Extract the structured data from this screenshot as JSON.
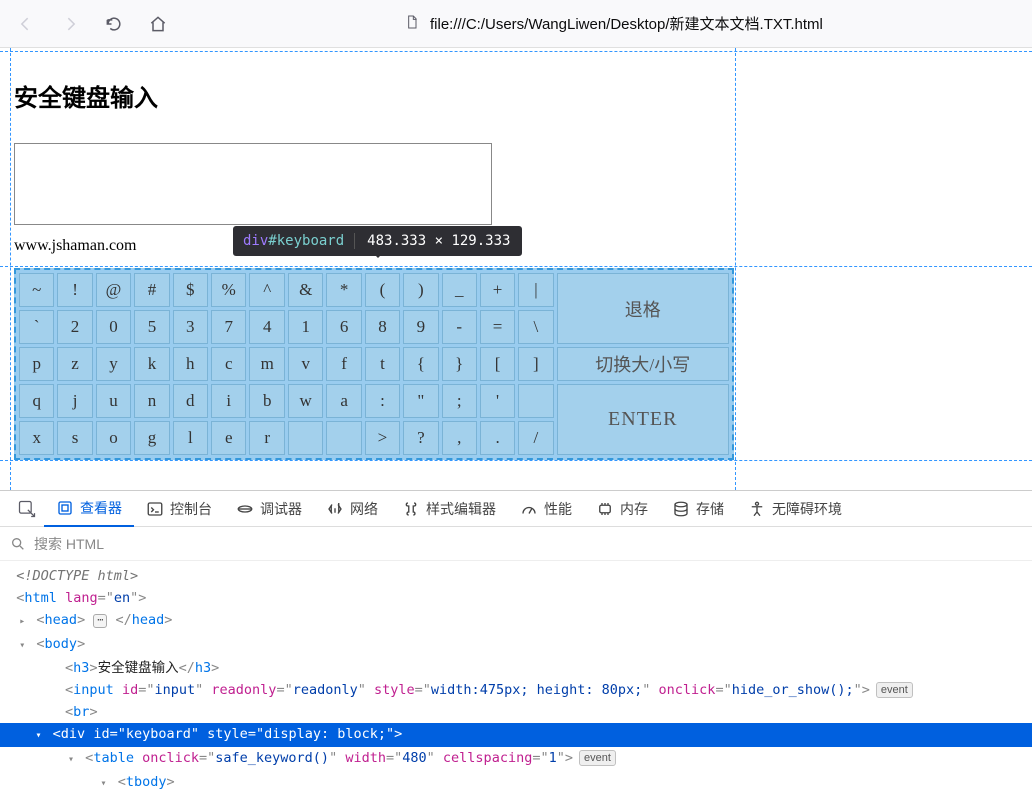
{
  "browser": {
    "url": "file:///C:/Users/WangLiwen/Desktop/新建文本文档.TXT.html"
  },
  "page": {
    "title": "安全键盘输入",
    "domain_text": "www.jshaman.com"
  },
  "tooltip": {
    "tag": "div",
    "id": "#keyboard",
    "size": "483.333 × 129.333"
  },
  "keyboard": {
    "rows": [
      [
        "~",
        "!",
        "@",
        "#",
        "$",
        "%",
        "^",
        "&",
        "*",
        "(",
        ")",
        "_",
        "+",
        "|"
      ],
      [
        "`",
        "2",
        "0",
        "5",
        "3",
        "7",
        "4",
        "1",
        "6",
        "8",
        "9",
        "-",
        "=",
        "\\"
      ],
      [
        "p",
        "z",
        "y",
        "k",
        "h",
        "c",
        "m",
        "v",
        "f",
        "t",
        "{",
        "}",
        "[",
        "]"
      ],
      [
        "q",
        "j",
        "u",
        "n",
        "d",
        "i",
        "b",
        "w",
        "a",
        ":",
        "\"",
        ";",
        "'"
      ],
      [
        "x",
        "s",
        "o",
        "g",
        "l",
        "e",
        "r",
        "",
        "",
        ">",
        "?",
        ",",
        ".",
        "/"
      ]
    ],
    "side": {
      "backspace": "退格",
      "case": "切换大/小写",
      "enter": "ENTER"
    }
  },
  "devtools": {
    "tabs": {
      "inspect": "查看器",
      "console": "控制台",
      "debugger": "调试器",
      "network": "网络",
      "style": "样式编辑器",
      "perf": "性能",
      "memory": "内存",
      "storage": "存储",
      "accessibility": "无障碍环境"
    },
    "search_placeholder": "搜索 HTML",
    "tree": {
      "doctype": "<!DOCTYPE html>",
      "h3_text": "安全键盘输入",
      "input_id": "input",
      "input_readonly": "readonly",
      "input_style": "width:475px; height: 80px;",
      "input_onclick": "hide_or_show();",
      "div_id": "keyboard",
      "div_style": "display: block;",
      "table_onclick": "safe_keyword()",
      "table_width": "480",
      "table_cellspacing": "1",
      "lang": "en",
      "event_label": "event"
    }
  }
}
